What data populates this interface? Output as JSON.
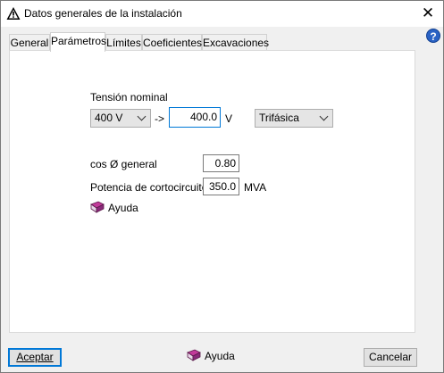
{
  "window": {
    "title": "Datos generales de la instalación",
    "close_glyph": "✕",
    "help_glyph": "?"
  },
  "tabs": [
    "General",
    "Parámetros",
    "Límites",
    "Coeficientes",
    "Excavaciones"
  ],
  "active_tab": "Parámetros",
  "params": {
    "tension_label": "Tensión nominal",
    "tension_select": "400 V",
    "arrow": "->",
    "tension_value": "400.0",
    "tension_unit": "V",
    "phase_select": "Trifásica",
    "cos_label": "cos Ø general",
    "cos_value": "0.80",
    "short_label": "Potencia de cortocircuito",
    "short_value": "350.0",
    "short_unit": "MVA",
    "help_label": "Ayuda"
  },
  "footer": {
    "accept": "Aceptar",
    "help": "Ayuda",
    "cancel": "Cancelar"
  },
  "colors": {
    "accent": "#0078d7",
    "warning_icon": "#000000"
  },
  "icons": [
    "warning-icon",
    "close-icon",
    "help-icon",
    "book-icon",
    "chevron-down-icon"
  ]
}
